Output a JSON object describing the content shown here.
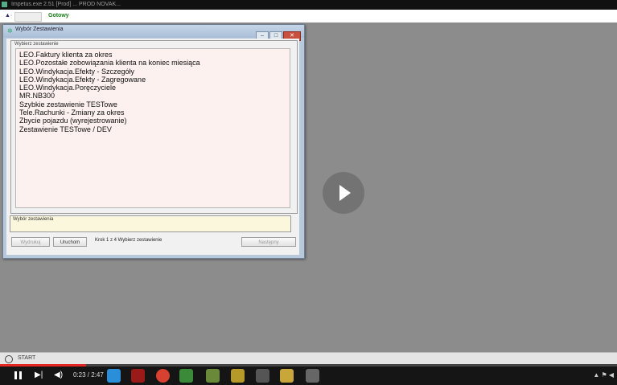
{
  "window": {
    "title": "Impetus.exe  2.51  [Prod]  ...  PROD  NOVAK..."
  },
  "toolbar": {
    "status": "Gotowy"
  },
  "dialog": {
    "title": "Wybór Zestawienia",
    "group_label": "Wybierz zestawienie",
    "reports": [
      "LEO.Faktury klienta za okres",
      "LEO.Pozostałe zobowiązania klienta na koniec miesiąca",
      "LEO.Windykacja.Efekty - Szczegóły",
      "LEO.Windykacja.Efekty - Zagregowane",
      "LEO.Windykacja.Poręczyciele",
      "MR.NB300",
      "Szybkie zestawienie TESTowe",
      "Tele.Rachunki - Zmiany za okres",
      "Zbycie pojazdu (wyrejestrowanie)",
      "Zestawienie TESTowe / DEV"
    ],
    "description_label": "Wybór zestawienia",
    "btn_left": "Wydrukuj",
    "btn_mid": "Uruchom",
    "hint": "Krok 1 z 4 Wybierz zestawienie",
    "btn_right": "Następny"
  },
  "bottom_panel": {
    "label": "START"
  },
  "video": {
    "time": "0:23 / 2:47",
    "progress": 0.14
  }
}
